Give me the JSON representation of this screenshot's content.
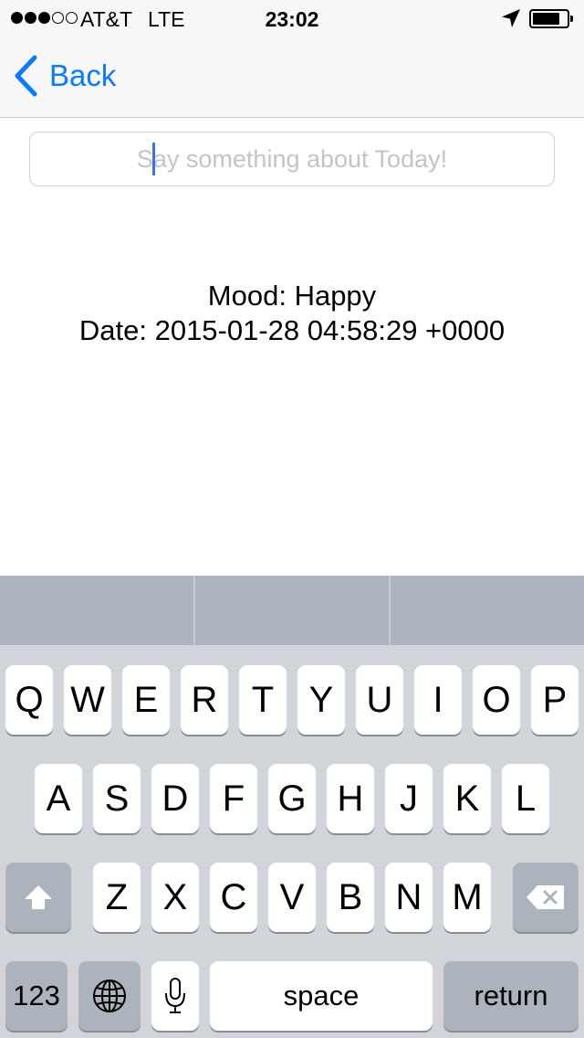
{
  "status_bar": {
    "signal_bars_filled": 3,
    "signal_bars_total": 5,
    "carrier": "AT&T",
    "network": "LTE",
    "time": "23:02",
    "battery_level": 0.8,
    "icons": [
      "location-arrow-icon",
      "battery-icon"
    ]
  },
  "nav": {
    "back_label": "Back",
    "accent_color": "#0a7aff"
  },
  "entry": {
    "placeholder": "Say something about Today!",
    "value": ""
  },
  "details": {
    "mood": "Mood: Happy",
    "date": "Date: 2015-01-28 04:58:29 +0000"
  },
  "keyboard": {
    "row1": [
      "Q",
      "W",
      "E",
      "R",
      "T",
      "Y",
      "U",
      "I",
      "O",
      "P"
    ],
    "row2": [
      "A",
      "S",
      "D",
      "F",
      "G",
      "H",
      "J",
      "K",
      "L"
    ],
    "row3": [
      "Z",
      "X",
      "C",
      "V",
      "B",
      "N",
      "M"
    ],
    "numbers_label": "123",
    "space_label": "space",
    "return_label": "return",
    "icons": [
      "shift-icon",
      "backspace-icon",
      "globe-icon",
      "microphone-icon"
    ]
  }
}
